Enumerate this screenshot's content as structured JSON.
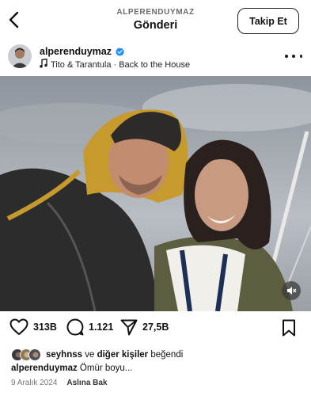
{
  "header": {
    "username": "ALPERENDUYMAZ",
    "title": "Gönderi",
    "follow_label": "Takip Et"
  },
  "post": {
    "username": "alperenduymaz",
    "music": "Tito & Tarantula · Back to the House"
  },
  "actions": {
    "likes": "313B",
    "comments": "1.121",
    "shares": "27,5B"
  },
  "liked_by": {
    "first": "seyhnss",
    "connector": " ve ",
    "others": "diğer kişiler",
    "suffix": " beğendi"
  },
  "caption": {
    "username": "alperenduymaz",
    "text": " Ömür boyu..."
  },
  "meta": {
    "date": "9 Aralık 2024",
    "translate": "Aslına Bak"
  },
  "icons": [
    "back-arrow-icon",
    "verified-badge-icon",
    "music-note-icon",
    "more-options-icon",
    "muted-speaker-icon",
    "heart-icon",
    "comment-icon",
    "share-icon",
    "bookmark-icon"
  ],
  "colors": {
    "verified": "#1f8ff2",
    "text": "#111111",
    "muted_text": "#777777"
  }
}
